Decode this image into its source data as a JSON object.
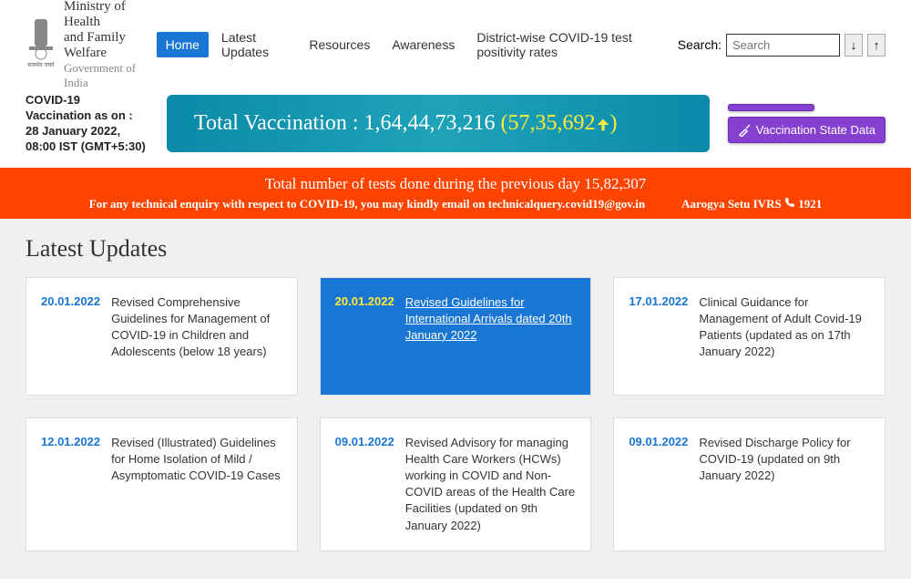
{
  "header": {
    "ministry_line1": "Ministry of Health",
    "ministry_line2": "and Family Welfare",
    "gov_line": "Government of India",
    "emblem_text": "सत्यमेव जयते"
  },
  "nav": {
    "items": [
      "Home",
      "Latest Updates",
      "Resources",
      "Awareness",
      "District-wise COVID-19 test positivity rates"
    ],
    "active_index": 0
  },
  "search": {
    "label": "Search:",
    "placeholder": "Search",
    "down": "↓",
    "up": "↑"
  },
  "vaccination": {
    "date_label": "COVID-19 Vaccination as on : 28 January 2022, 08:00 IST (GMT+5:30)",
    "total_label": "Total Vaccination : ",
    "total_number": "1,64,44,73,216",
    "delta": " (57,35,692",
    "delta_suffix": ")",
    "state_btn": "Vaccination State Data"
  },
  "banner": {
    "line1": "Total number of tests done during the previous day 15,82,307",
    "line2a": "For any technical enquiry with respect to COVID-19, you may kindly email on technicalquery.covid19@gov.in",
    "line2b": "Aarogya Setu IVRS ",
    "line2c": " 1921"
  },
  "section": {
    "title": "Latest Updates"
  },
  "cards": [
    {
      "date": "20.01.2022",
      "text": "Revised Comprehensive Guidelines for Management of COVID-19 in Children and Adolescents (below 18 years)",
      "highlight": false
    },
    {
      "date": "20.01.2022",
      "text": "Revised Guidelines for International Arrivals dated 20th January 2022",
      "highlight": true
    },
    {
      "date": "17.01.2022",
      "text": "Clinical Guidance for Management of Adult Covid-19 Patients (updated as on 17th January 2022)",
      "highlight": false
    },
    {
      "date": "12.01.2022",
      "text": "Revised (Illustrated) Guidelines for Home Isolation of Mild / Asymptomatic COVID-19 Cases",
      "highlight": false
    },
    {
      "date": "09.01.2022",
      "text": "Revised Advisory for managing Health Care Workers (HCWs) working in COVID and Non-COVID areas of the Health Care Facilities (updated on 9th January 2022)",
      "highlight": false
    },
    {
      "date": "09.01.2022",
      "text": "Revised Discharge Policy for COVID-19 (updated on 9th January 2022)",
      "highlight": false
    }
  ]
}
